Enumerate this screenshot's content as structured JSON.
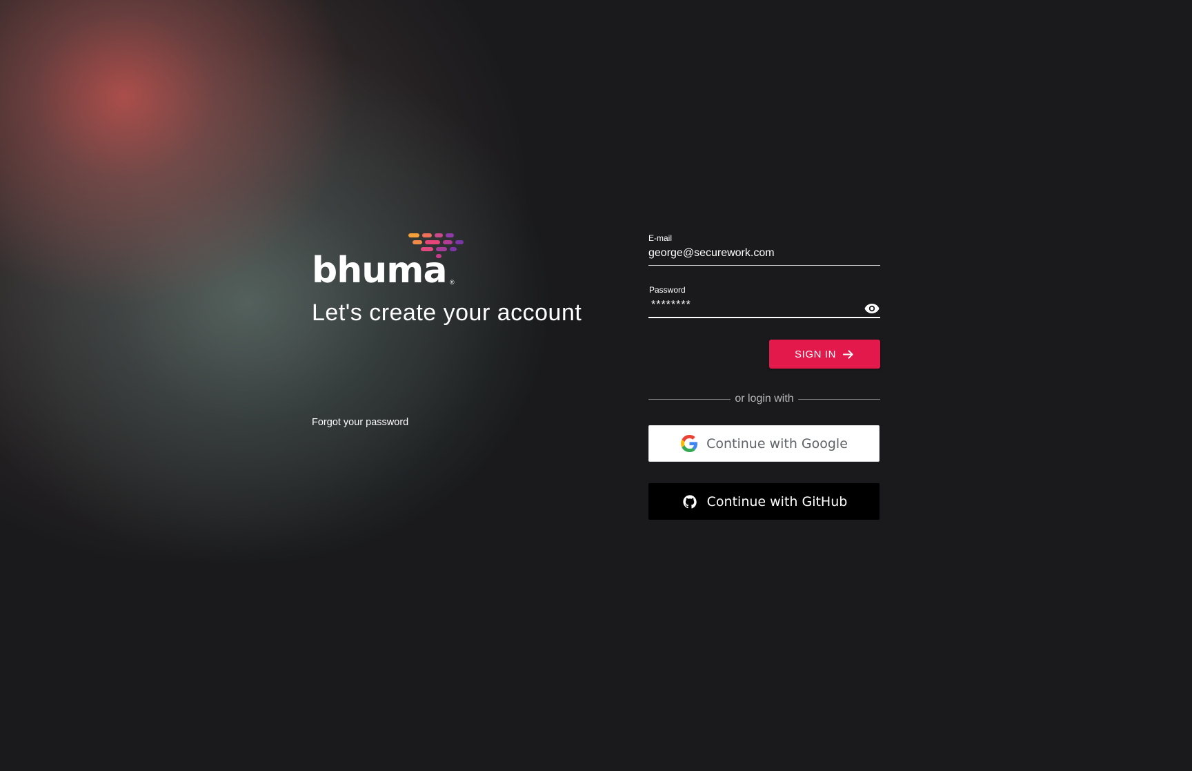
{
  "brand": {
    "logo_text": "bhuma",
    "logo_mark": "®",
    "heading": "Let's create your account",
    "forgot_password": "Forgot your password"
  },
  "form": {
    "email_label": "E-mail",
    "email_value": "george@securework.com",
    "password_label": "Password",
    "password_value": "********",
    "password_toggle_icon": "eye-icon",
    "sign_in_label": "SIGN IN",
    "sign_in_icon": "arrow-right-icon",
    "divider_text": "or login with",
    "google_label": "Continue with Google",
    "github_label": "Continue with GitHub"
  },
  "colors": {
    "background": "#1a1a1c",
    "accent": "#e3194b",
    "logo_dash_orange": "#f4a13a",
    "logo_dash_pink": "#e6457a",
    "logo_dash_purple": "#8e3aa8"
  }
}
